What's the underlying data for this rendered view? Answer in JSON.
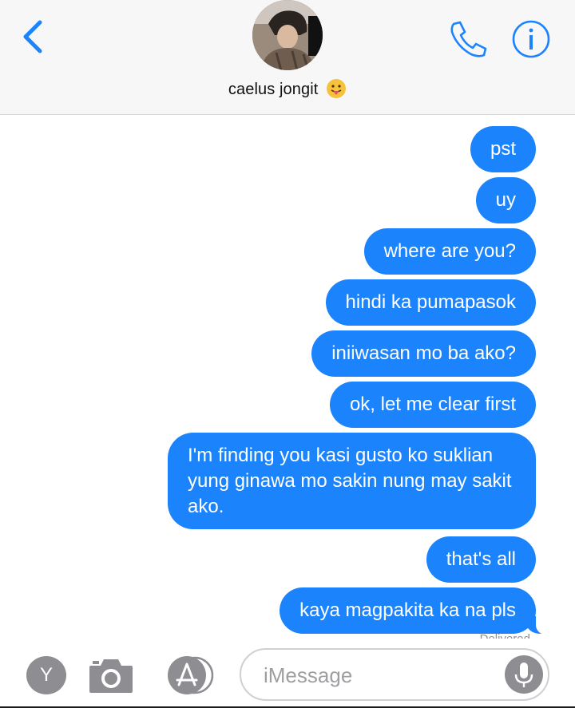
{
  "header": {
    "contact_name": "caelus jongit",
    "name_emoji": "tongue-face-emoji",
    "icons": [
      "chevron-left-icon",
      "phone-icon",
      "info-icon"
    ],
    "accent_color": "#1b84fd"
  },
  "messages": [
    {
      "text": "pst",
      "sender": "me"
    },
    {
      "text": "uy",
      "sender": "me"
    },
    {
      "text": "where are you?",
      "sender": "me"
    },
    {
      "text": "hindi ka pumapasok",
      "sender": "me"
    },
    {
      "text": "iniiwasan mo ba ako?",
      "sender": "me"
    },
    {
      "text": "ok, let me clear first",
      "sender": "me"
    },
    {
      "text": "I'm finding you kasi gusto ko suklian yung ginawa mo sakin nung may sakit ako.",
      "sender": "me"
    },
    {
      "text": "that's all",
      "sender": "me"
    },
    {
      "text": "kaya magpakita ka na pls",
      "sender": "me"
    }
  ],
  "delivered_label": "Delivered",
  "input_bar": {
    "y_label": "Y",
    "placeholder": "iMessage",
    "icons": [
      "camera-icon",
      "app-store-icon",
      "microphone-icon"
    ]
  }
}
